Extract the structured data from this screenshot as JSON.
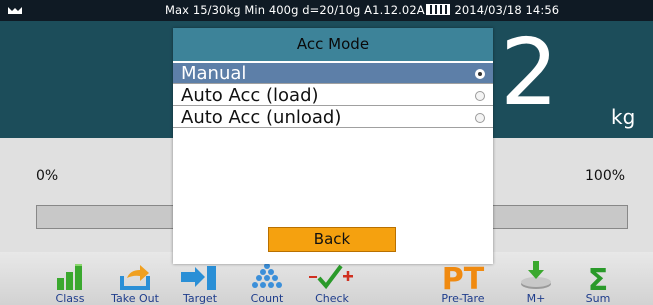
{
  "status_bar": {
    "text_before_battery": "Max 15/30kg  Min 400g  d=20/10g   A1.12.02A",
    "text_after_battery": " 2014/03/18  14:56"
  },
  "weight": {
    "value": "2",
    "unit": "kg"
  },
  "progress": {
    "min_label": "0%",
    "max_label": "100%",
    "value_percent": 0
  },
  "dialog": {
    "title": "Acc Mode",
    "options": [
      {
        "label": "Manual",
        "selected": true
      },
      {
        "label": "Auto Acc (load)",
        "selected": false
      },
      {
        "label": "Auto Acc (unload)",
        "selected": false
      }
    ],
    "back_label": "Back"
  },
  "toolbar": {
    "items": [
      {
        "label": "Class",
        "icon": "class-icon"
      },
      {
        "label": "Take Out",
        "icon": "take-out-icon"
      },
      {
        "label": "Target",
        "icon": "target-icon"
      },
      {
        "label": "Count",
        "icon": "count-icon"
      },
      {
        "label": "Check",
        "icon": "check-icon"
      },
      {
        "label": "Pre-Tare",
        "icon": "pre-tare-icon"
      },
      {
        "label": "M+",
        "icon": "memory-add-icon"
      },
      {
        "label": "Sum",
        "icon": "sum-icon"
      }
    ]
  },
  "colors": {
    "status_bar": "#0f1a24",
    "weight_panel": "#1c4d5a",
    "dialog_title": "#3d8399",
    "selected_option": "#5d7fa8",
    "back_button": "#f5a10f",
    "toolbar_label": "#1f3d8c"
  }
}
